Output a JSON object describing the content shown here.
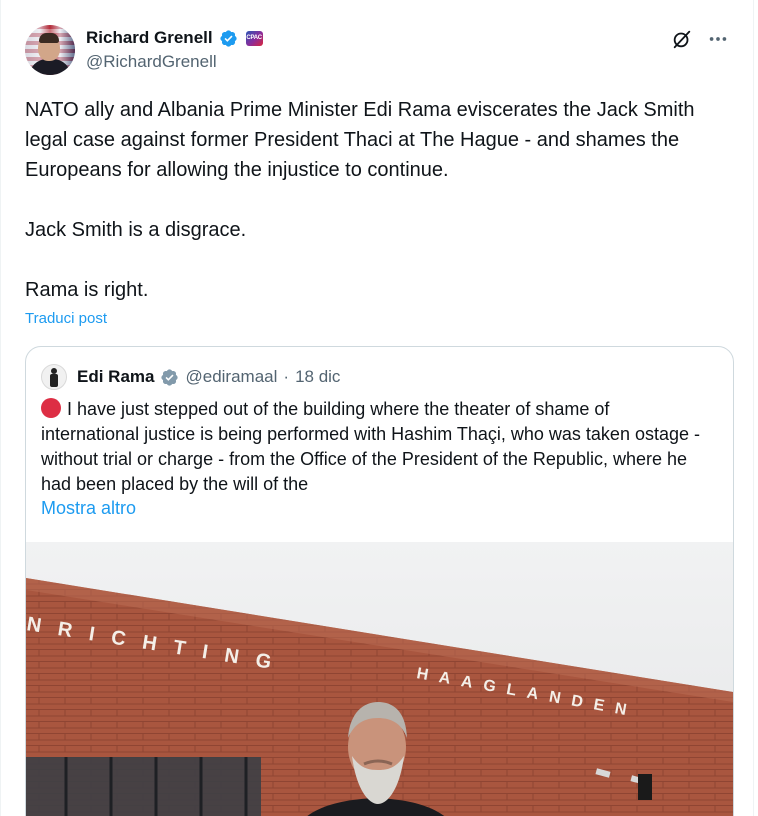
{
  "author": {
    "display_name": "Richard Grenell",
    "handle": "@RichardGrenell",
    "affiliate_badge_text": "CPAC"
  },
  "post": {
    "paragraphs": [
      "NATO ally and Albania Prime Minister Edi Rama eviscerates the Jack Smith legal case against former President Thaci at The Hague - and shames the Europeans for allowing the injustice to continue.",
      "Jack Smith is a disgrace.",
      "Rama is right."
    ],
    "translate_label": "Traduci post"
  },
  "quote": {
    "display_name": "Edi Rama",
    "handle": "@ediramaal",
    "separator": "·",
    "date": "18 dic",
    "text": "I have just stepped out of the building where the theater of shame of international justice is being performed with Hashim Thaçi, who was taken ostage - without trial or charge - from the Office of the President of the Republic, where he had been placed by the will of the",
    "show_more_label": "Mostra altro",
    "image": {
      "sign_line_1": "NRICHTING",
      "sign_line_2": "HAAGLANDEN"
    }
  },
  "colors": {
    "text_primary": "#0f1419",
    "text_secondary": "#536471",
    "link": "#1d9bf0",
    "verified": "#1d9bf0",
    "border": "#cfd9de",
    "brick": "#a5503b"
  },
  "icons": {
    "grok": "grok-icon",
    "more": "more-icon",
    "verified": "verified-badge-icon"
  }
}
